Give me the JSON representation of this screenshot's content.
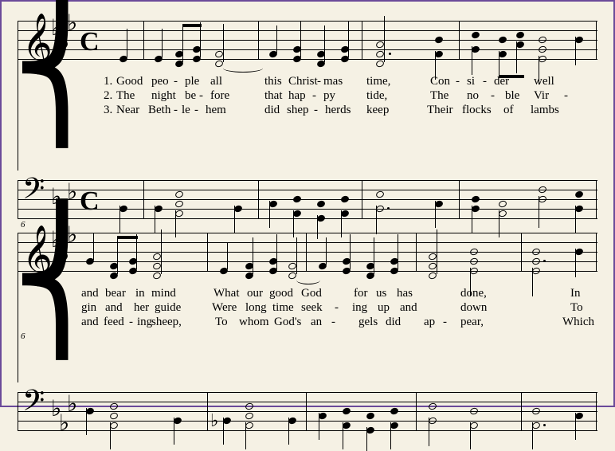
{
  "score": {
    "key_signature": "E♭ major (3 flats)",
    "time_signature": "C",
    "systems": [
      {
        "measure_start": 1,
        "staves": [
          "treble",
          "bass"
        ],
        "lyrics": [
          {
            "verse": 1,
            "syllables": [
              "1.",
              "Good",
              "peo",
              "-",
              "ple",
              "all",
              "this",
              "Christ",
              "-",
              "mas",
              "time,",
              "Con",
              "-",
              "si",
              "-",
              "der",
              "well"
            ]
          },
          {
            "verse": 2,
            "syllables": [
              "2.",
              "The",
              "night",
              "be",
              "-",
              "fore",
              "that",
              "hap",
              "-",
              "py",
              "tide,",
              "The",
              "no",
              "-",
              "ble",
              "Vir",
              "-"
            ]
          },
          {
            "verse": 3,
            "syllables": [
              "3.",
              "Near",
              "Beth",
              "-",
              "le",
              "-",
              "hem",
              "did",
              "shep",
              "-",
              "herds",
              "keep",
              "Their",
              "flocks",
              "of",
              "lambs"
            ]
          }
        ]
      },
      {
        "measure_start": 6,
        "staves": [
          "treble",
          "bass"
        ],
        "lyrics": [
          {
            "verse": 1,
            "syllables": [
              "and",
              "bear",
              "in",
              "mind",
              "What",
              "our",
              "good",
              "God",
              "for",
              "us",
              "has",
              "done,",
              "In"
            ]
          },
          {
            "verse": 2,
            "syllables": [
              "gin",
              "and",
              "her",
              "guide",
              "Were",
              "long",
              "time",
              "seek",
              "-",
              "ing",
              "up",
              "and",
              "down",
              "To"
            ]
          },
          {
            "verse": 3,
            "syllables": [
              "and",
              "feed",
              "-",
              "ing",
              "sheep,",
              "To",
              "whom",
              "God's",
              "an",
              "-",
              "gels",
              "did",
              "ap",
              "-",
              "pear,",
              "Which"
            ]
          }
        ]
      }
    ]
  },
  "measure_numbers": {
    "system2_treble": "6",
    "system2_bass": "6"
  },
  "flat_glyph": "♭",
  "common_time": "𝄴"
}
